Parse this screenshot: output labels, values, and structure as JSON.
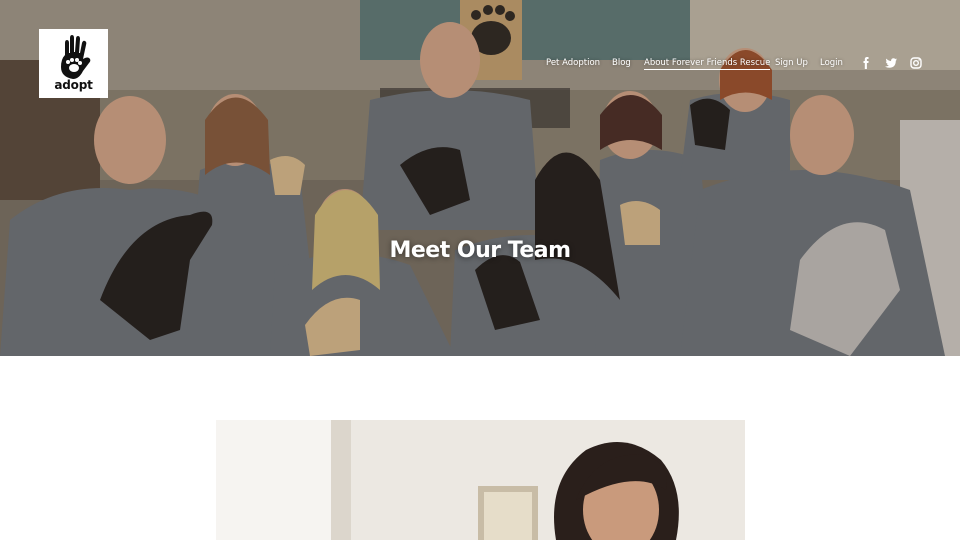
{
  "brand": {
    "logo_text": "adopt",
    "logo_icon": "handprint-paw-icon"
  },
  "nav": {
    "items": [
      {
        "label": "Pet Adoption",
        "active": false
      },
      {
        "label": "Blog",
        "active": false
      },
      {
        "label": "About Forever Friends Rescue",
        "active": true
      },
      {
        "label": "Sign Up",
        "active": false
      },
      {
        "label": "Login",
        "active": false
      }
    ],
    "social": [
      "facebook-icon",
      "twitter-icon",
      "instagram-icon"
    ]
  },
  "hero": {
    "title": "Meet Our Team"
  },
  "colors": {
    "nav_text": "#ffffff",
    "hero_overlay": "#4a4037",
    "page_background": "#ffffff"
  }
}
